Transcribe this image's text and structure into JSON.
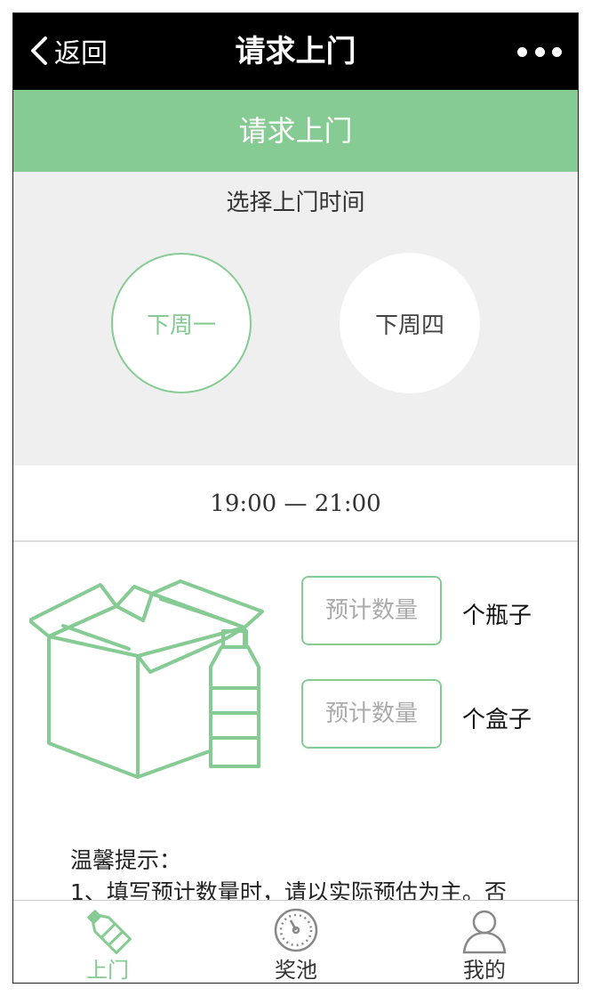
{
  "nav": {
    "back_label": "返回",
    "title": "请求上门",
    "more_icon": "more-dots-icon"
  },
  "header": {
    "title": "请求上门"
  },
  "time_select": {
    "title": "选择上门时间",
    "options": [
      {
        "label": "下周一",
        "selected": true
      },
      {
        "label": "下周四",
        "selected": false
      }
    ],
    "range": "19:00 — 21:00"
  },
  "quantity": {
    "bottles": {
      "placeholder": "预计数量",
      "unit": "个瓶子"
    },
    "boxes": {
      "placeholder": "预计数量",
      "unit": "个盒子"
    }
  },
  "tips": {
    "title": "温馨提示：",
    "line1": "1、填写预计数量时，请以实际预估为主。否"
  },
  "tabbar": {
    "items": [
      {
        "label": "上门",
        "icon": "bottle-icon",
        "active": true
      },
      {
        "label": "奖池",
        "icon": "dial-icon",
        "active": false
      },
      {
        "label": "我的",
        "icon": "user-icon",
        "active": false
      }
    ]
  },
  "colors": {
    "accent": "#86cb93",
    "nav_bg": "#000000",
    "section_bg": "#efefef"
  }
}
